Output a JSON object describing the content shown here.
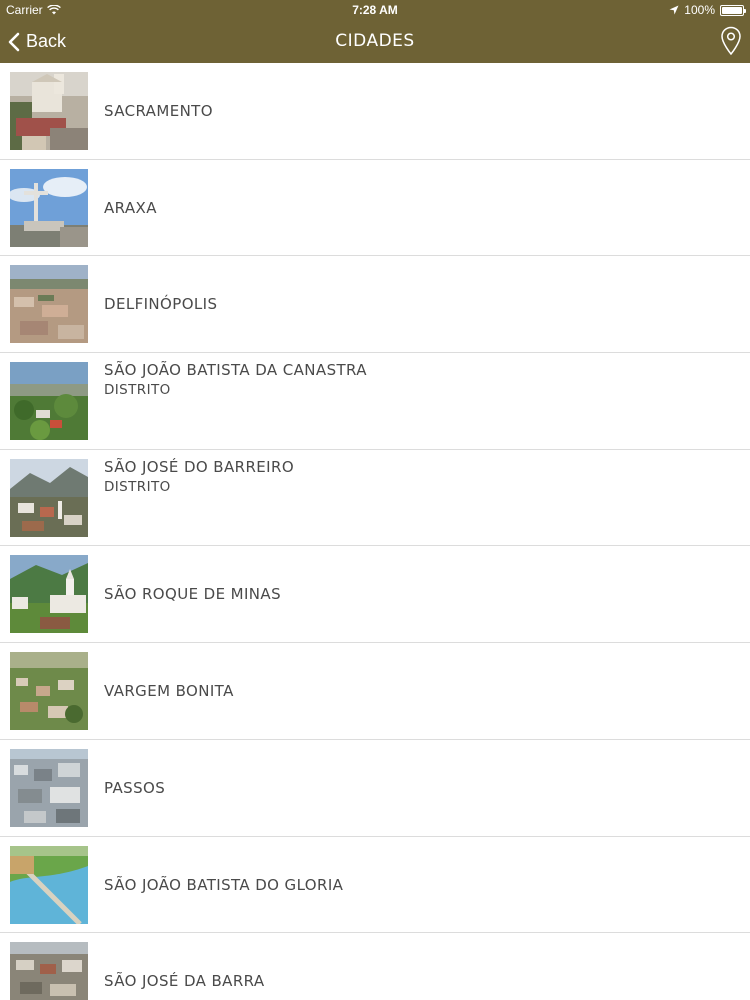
{
  "status": {
    "carrier": "Carrier",
    "time": "7:28 AM",
    "battery": "100%"
  },
  "nav": {
    "back_label": "Back",
    "title": "CIDADES",
    "right_icon": "location-pin-icon"
  },
  "cities": [
    {
      "name": "SACRAMENTO",
      "sub": ""
    },
    {
      "name": "ARAXA",
      "sub": ""
    },
    {
      "name": "DELFINÓPOLIS",
      "sub": ""
    },
    {
      "name": "SÃO JOÃO BATISTA DA CANASTRA",
      "sub": "DISTRITO"
    },
    {
      "name": "SÃO JOSÉ DO BARREIRO",
      "sub": "DISTRITO"
    },
    {
      "name": "SÃO ROQUE DE MINAS",
      "sub": ""
    },
    {
      "name": "VARGEM BONITA",
      "sub": ""
    },
    {
      "name": "PASSOS",
      "sub": ""
    },
    {
      "name": "SÃO JOÃO BATISTA DO GLORIA",
      "sub": ""
    },
    {
      "name": "SÃO JOSÉ DA BARRA",
      "sub": ""
    }
  ],
  "colors": {
    "bar": "#6e6235",
    "text": "#4a4a4a",
    "separator": "#dcdcdc"
  }
}
